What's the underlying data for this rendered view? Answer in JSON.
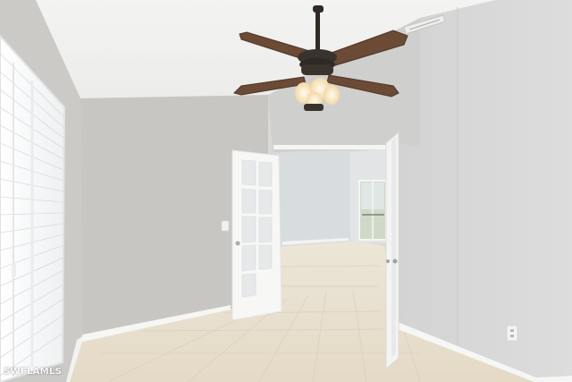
{
  "watermark": {
    "text": "SWFLAMLS"
  },
  "colors": {
    "wall_left": "#c9c8c5",
    "wall_back": "#c6c5c2",
    "wall_right": "#d6d7d6",
    "ceiling": "#f1f1ef",
    "floor_tile": "#e7dfcf",
    "baseboard": "#fafaf8",
    "fan_blade": "#6b4a36",
    "fan_body": "#2f2a26",
    "light_glow": "#fff3d6",
    "door": "#f7f7f5",
    "glass": "#e3e6e8"
  },
  "icons": {
    "ceiling_fan": "ceiling-fan-icon",
    "window_blinds": "window-blinds-icon",
    "french_door": "french-door-icon",
    "power_outlet": "power-outlet-icon",
    "light_switch": "light-switch-icon",
    "air_vent": "air-vent-icon"
  }
}
